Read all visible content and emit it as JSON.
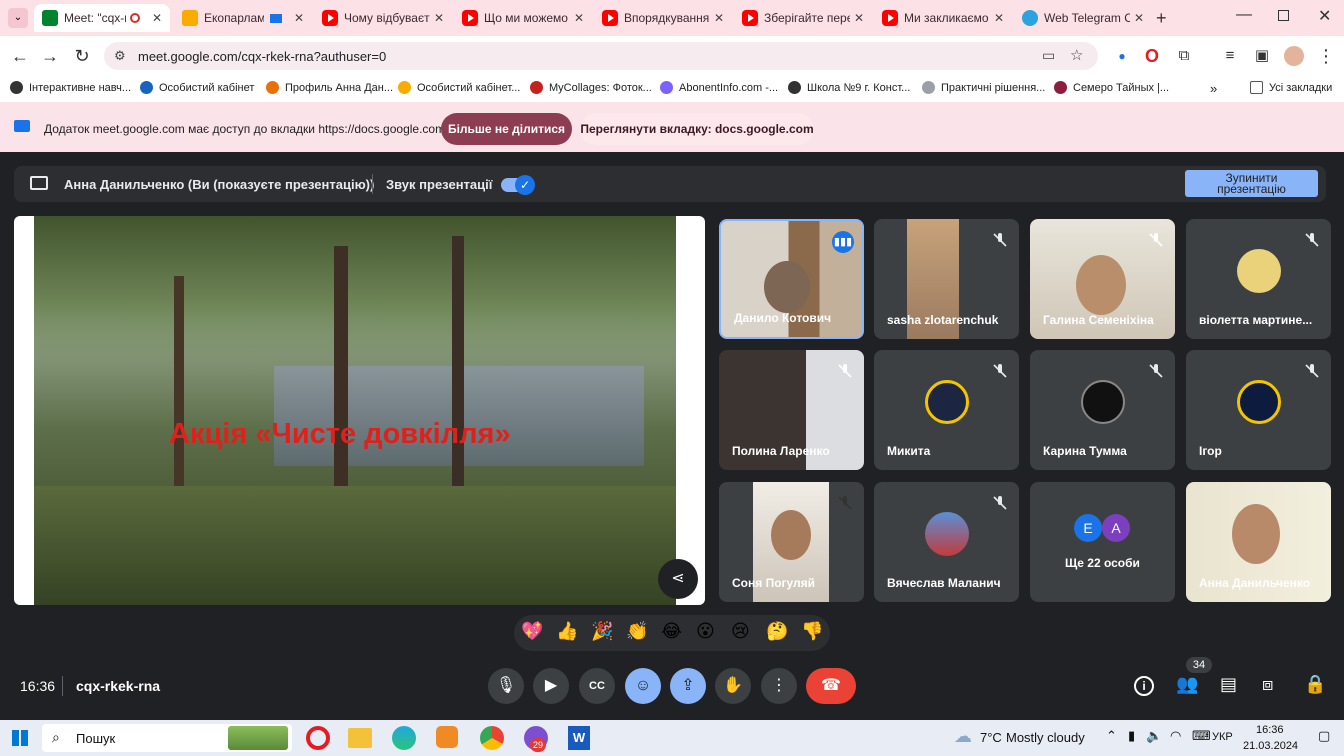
{
  "tabs": [
    {
      "title": "Meet: \"cqx-rk",
      "fav": "meet"
    },
    {
      "title": "Екопарламе",
      "fav": "slides"
    },
    {
      "title": "Чому відбуваєт",
      "fav": "youtube"
    },
    {
      "title": "Що ми можемо",
      "fav": "youtube"
    },
    {
      "title": "Впорядкування",
      "fav": "youtube"
    },
    {
      "title": "Зберігайте пере",
      "fav": "youtube"
    },
    {
      "title": "Ми закликаємо",
      "fav": "youtube"
    },
    {
      "title": "Web Telegram C",
      "fav": "telegram"
    }
  ],
  "address": {
    "url": "meet.google.com/cqx-rkek-rna?authuser=0"
  },
  "bookmarks": [
    {
      "label": "Інтерактивне навч..."
    },
    {
      "label": "Особистий кабінет"
    },
    {
      "label": "Профиль Анна Дан..."
    },
    {
      "label": "Особистий кабінет..."
    },
    {
      "label": "MyCollages: Фоток..."
    },
    {
      "label": "AbonentInfo.com -..."
    },
    {
      "label": "Школа №9 г. Конст..."
    },
    {
      "label": "Практичні рішення..."
    },
    {
      "label": "Семеро Тайных |..."
    }
  ],
  "bookmarks_more": "»",
  "all_bookmarks": "Усі закладки",
  "infobar": {
    "message": "Додаток meet.google.com має доступ до вкладки https://docs.google.com",
    "stop_sharing": "Більше не ділитися",
    "view_tab": "Переглянути вкладку: docs.google.com"
  },
  "presenting": {
    "label": "Анна Данильченко (Ви (показуєте презентацію))",
    "audio_label": "Звук презентації",
    "stop_line1": "Зупинити",
    "stop_line2": "презентацію"
  },
  "slide": {
    "title": "Акція «Чисте довкілля»"
  },
  "participants": [
    {
      "name": "Данило Котович",
      "speaking": true
    },
    {
      "name": "sasha zlotarenchuk",
      "muted": true
    },
    {
      "name": "Галина Семеніхіна",
      "muted": true
    },
    {
      "name": "віолетта мартине...",
      "muted": true
    },
    {
      "name": "Полина Ларенко",
      "muted": true
    },
    {
      "name": "Микита",
      "muted": true
    },
    {
      "name": "Карина Тумма",
      "muted": true
    },
    {
      "name": "Ігор",
      "muted": true
    },
    {
      "name": "Соня Погуляй",
      "muted": true
    },
    {
      "name": "Вячеслав Маланич",
      "muted": true
    },
    {
      "name": "Ще 22 особи",
      "initials": [
        "E",
        "A"
      ]
    },
    {
      "name": "Анна Данильченко"
    }
  ],
  "reactions": [
    "💖",
    "👍",
    "🎉",
    "👏",
    "😂",
    "😮",
    "😢",
    "🤔",
    "👎"
  ],
  "bottom": {
    "time": "16:36",
    "meeting_code": "cqx-rkek-rna",
    "participant_count": "34"
  },
  "taskbar": {
    "search": "Пошук",
    "weather": "7°C",
    "weather_desc": "Mostly cloudy",
    "lang": "УКР",
    "clock_time": "16:36",
    "clock_date": "21.03.2024",
    "badge": "29"
  },
  "colors": {
    "accent": "#8ab4f8",
    "end_call": "#ea4335",
    "infobar_button": "#8c3d52",
    "slide_title": "#e0211b"
  }
}
